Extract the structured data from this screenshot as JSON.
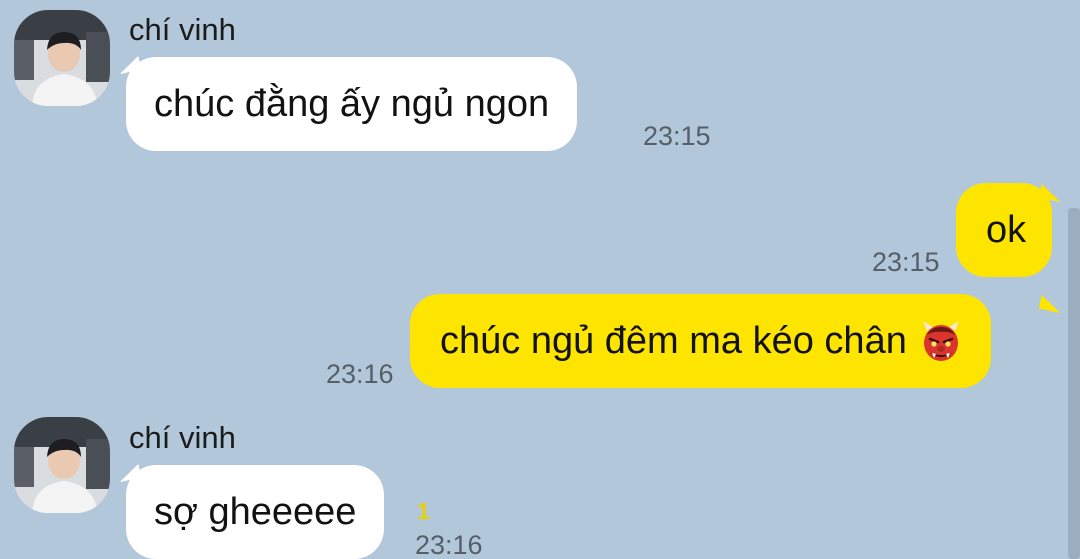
{
  "colors": {
    "background": "#b2c7d9",
    "incoming_bubble": "#ffffff",
    "outgoing_bubble": "#fee500",
    "unread_count": "#e8cf00"
  },
  "messages": [
    {
      "direction": "incoming",
      "sender": "chí vinh",
      "text": "chúc đằng ấy ngủ ngon",
      "time": "23:15"
    },
    {
      "direction": "outgoing",
      "text": "ok",
      "time": "23:15"
    },
    {
      "direction": "outgoing",
      "text": "chúc ngủ đêm ma kéo chân",
      "emoji": "ogre-emoji",
      "time": "23:16"
    },
    {
      "direction": "incoming",
      "sender": "chí vinh",
      "text": "sợ gheeeee",
      "unread": "1",
      "time": "23:16"
    }
  ]
}
